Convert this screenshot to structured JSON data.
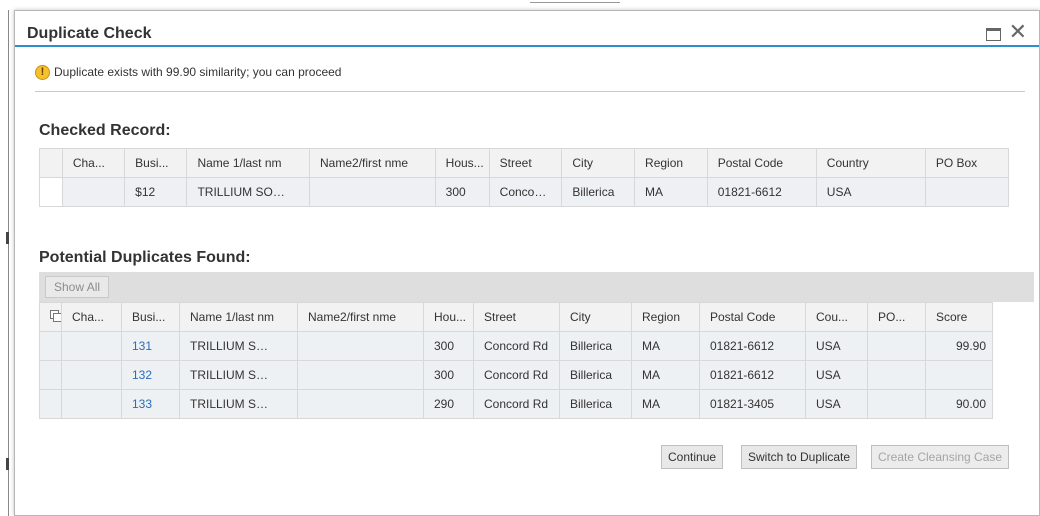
{
  "dialog": {
    "title": "Duplicate Check",
    "message": "Duplicate exists with 99.90 similarity; you can proceed"
  },
  "checked": {
    "section_title": "Checked Record:",
    "columns": [
      "Cha...",
      "Busi...",
      "Name 1/last nm",
      "Name2/first nme",
      "Hous...",
      "Street",
      "City",
      "Region",
      "Postal Code",
      "Country",
      "PO Box"
    ],
    "row": [
      "",
      "$12",
      "TRILLIUM SO…",
      "",
      "300",
      "Conco…",
      "Billerica",
      "MA",
      "01821-6612",
      "USA",
      ""
    ]
  },
  "duplicates": {
    "section_title": "Potential Duplicates Found:",
    "show_all": "Show All",
    "columns": [
      "Cha...",
      "Busi...",
      "Name 1/last nm",
      "Name2/first nme",
      "Hou...",
      "Street",
      "City",
      "Region",
      "Postal Code",
      "Cou...",
      "PO...",
      "Score"
    ],
    "rows": [
      [
        "",
        "131",
        "TRILLIUM S…",
        "",
        "300",
        "Concord Rd",
        "Billerica",
        "MA",
        "01821-6612",
        "USA",
        "",
        "99.90"
      ],
      [
        "",
        "132",
        "TRILLIUM S…",
        "",
        "300",
        "Concord Rd",
        "Billerica",
        "MA",
        "01821-6612",
        "USA",
        "",
        ""
      ],
      [
        "",
        "133",
        "TRILLIUM S…",
        "",
        "290",
        "Concord Rd",
        "Billerica",
        "MA",
        "01821-3405",
        "USA",
        "",
        "90.00"
      ]
    ]
  },
  "buttons": {
    "continue": "Continue",
    "switch": "Switch to Duplicate",
    "cleansing": "Create Cleansing Case"
  },
  "icons": {
    "warning": "warning-icon",
    "maximize": "maximize-icon",
    "close": "close-icon",
    "select_all": "select-all-icon"
  },
  "colors": {
    "accent": "#2d8ecd",
    "link": "#2a6db8"
  }
}
